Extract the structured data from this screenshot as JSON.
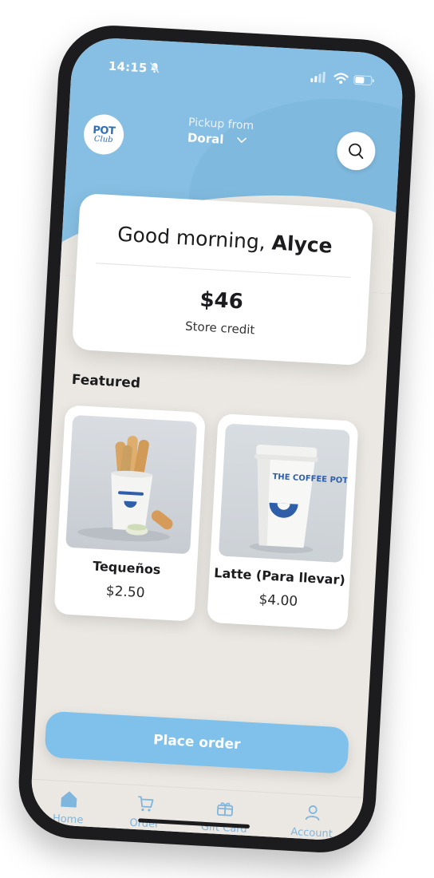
{
  "status_bar": {
    "time": "14:15"
  },
  "header": {
    "logo_top": "POT",
    "logo_bottom": "Club",
    "pickup_label": "Pickup from",
    "pickup_store": "Doral"
  },
  "greeting": {
    "prefix": "Good morning, ",
    "name": "Alyce",
    "credit_amount": "$46",
    "credit_label": "Store credit"
  },
  "featured": {
    "title": "Featured",
    "items": [
      {
        "name": "Tequeños",
        "price": "$2.50",
        "image_icon": "tequenos-image"
      },
      {
        "name": "Latte (Para llevar)",
        "price": "$4.00",
        "image_icon": "latte-cup-image",
        "cup_text": "THE COFFEE POT"
      }
    ]
  },
  "actions": {
    "place_order_label": "Place order"
  },
  "nav": {
    "items": [
      {
        "label": "Home",
        "icon": "home-icon"
      },
      {
        "label": "Order",
        "icon": "cart-icon"
      },
      {
        "label": "Gift Card",
        "icon": "gift-icon"
      },
      {
        "label": "Account",
        "icon": "user-icon"
      }
    ]
  },
  "colors": {
    "brand_blue": "#86bfe3",
    "button_blue": "#7fc1ea",
    "nav_blue": "#7fb6de",
    "background": "#ebe8e3"
  }
}
